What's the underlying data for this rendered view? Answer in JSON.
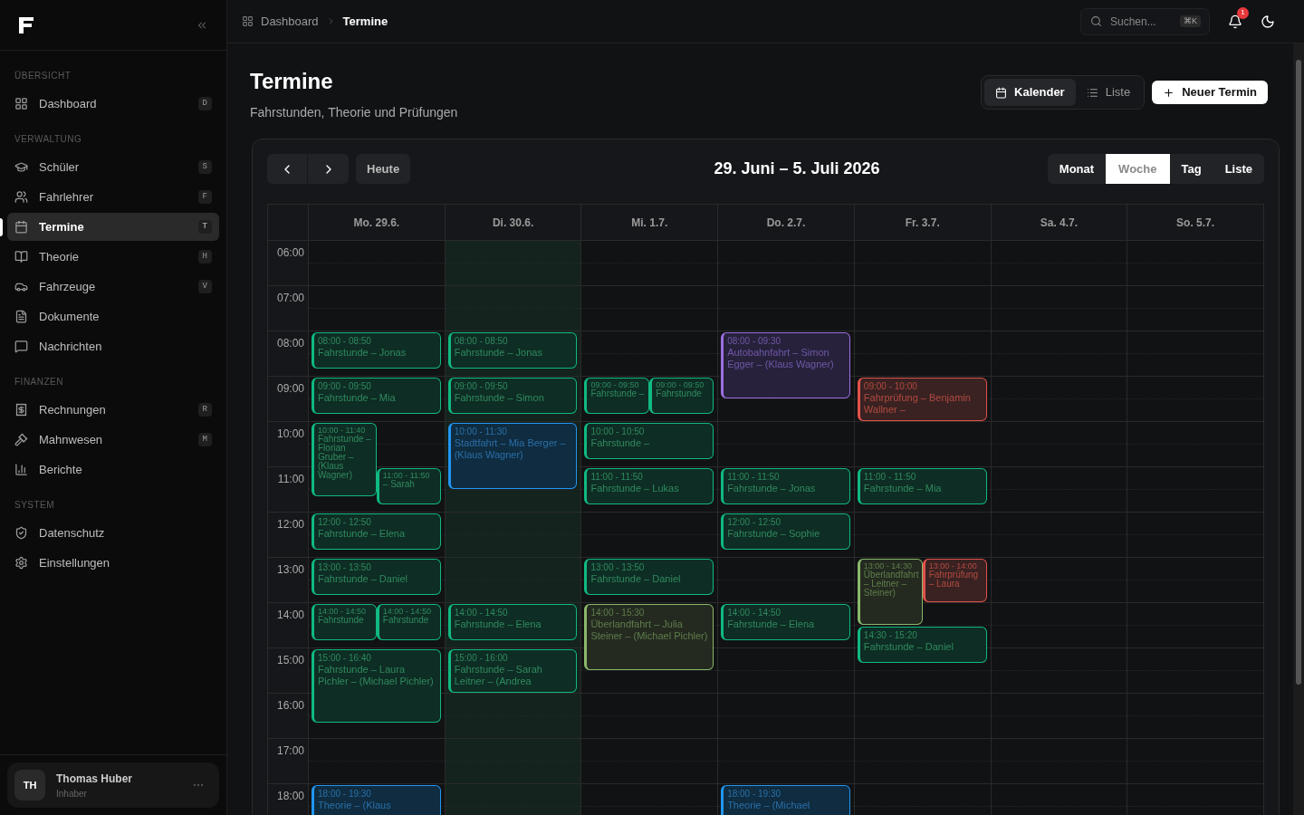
{
  "sidebar": {
    "sections": [
      {
        "title": "ÜBERSICHT",
        "items": [
          {
            "label": "Dashboard",
            "shortcut": "D",
            "selected": false
          }
        ]
      },
      {
        "title": "VERWALTUNG",
        "items": [
          {
            "label": "Schüler",
            "shortcut": "S",
            "selected": false
          },
          {
            "label": "Fahrlehrer",
            "shortcut": "F",
            "selected": false
          },
          {
            "label": "Termine",
            "shortcut": "T",
            "selected": true
          },
          {
            "label": "Theorie",
            "shortcut": "H",
            "selected": false
          },
          {
            "label": "Fahrzeuge",
            "shortcut": "V",
            "selected": false
          },
          {
            "label": "Dokumente",
            "selected": false
          },
          {
            "label": "Nachrichten",
            "selected": false
          }
        ]
      },
      {
        "title": "FINANZEN",
        "items": [
          {
            "label": "Rechnungen",
            "shortcut": "R",
            "selected": false
          },
          {
            "label": "Mahnwesen",
            "shortcut": "M",
            "selected": false
          },
          {
            "label": "Berichte",
            "selected": false
          }
        ]
      },
      {
        "title": "SYSTEM",
        "items": [
          {
            "label": "Datenschutz",
            "selected": false
          },
          {
            "label": "Einstellungen",
            "selected": false
          }
        ]
      }
    ],
    "user": {
      "initials": "TH",
      "name": "Thomas Huber",
      "role": "Inhaber"
    }
  },
  "topbar": {
    "breadcrumb": [
      "Dashboard",
      "Termine"
    ],
    "search": {
      "placeholder": "Suchen...",
      "shortcut": "⌘K"
    },
    "notifications": "1"
  },
  "header": {
    "title": "Termine",
    "subtitle": "Fahrstunden, Theorie und Prüfungen",
    "views": [
      {
        "label": "Kalender",
        "selected": true
      },
      {
        "label": "Liste",
        "selected": false
      }
    ],
    "new_button": "Neuer Termin"
  },
  "calendar": {
    "today_button": "Heute",
    "range": "29. Juni – 5. Juli 2026",
    "view_tabs": [
      {
        "label": "Monat",
        "selected": false
      },
      {
        "label": "Woche",
        "selected": true
      },
      {
        "label": "Tag",
        "selected": false
      },
      {
        "label": "Liste",
        "selected": false
      }
    ],
    "hours": [
      "06:00",
      "07:00",
      "08:00",
      "09:00",
      "10:00",
      "11:00",
      "12:00",
      "13:00",
      "14:00",
      "15:00",
      "16:00",
      "17:00",
      "18:00"
    ],
    "days": [
      {
        "label": "Mo. 29.6.",
        "today": false,
        "events": [
          {
            "kind": "lesson",
            "left_half": false,
            "right_half": false,
            "time": "08:00 - 08:50",
            "title": "Fahrstunde – Jonas"
          },
          {
            "kind": "lesson",
            "left_half": false,
            "right_half": false,
            "time": "09:00 - 09:50",
            "title": "Fahrstunde – Mia"
          },
          {
            "kind": "lesson",
            "left_half": true,
            "right_half": false,
            "time": "10:00 - 11:40",
            "title": "Fahrstunde – Florian Gruber – (Klaus Wagner)"
          },
          {
            "kind": "lesson",
            "left_half": false,
            "right_half": true,
            "time": "11:00 - 11:50",
            "title": "– Sarah"
          },
          {
            "kind": "lesson",
            "left_half": false,
            "right_half": false,
            "time": "12:00 - 12:50",
            "title": "Fahrstunde – Elena"
          },
          {
            "kind": "lesson",
            "left_half": false,
            "right_half": false,
            "time": "13:00 - 13:50",
            "title": "Fahrstunde – Daniel"
          },
          {
            "kind": "lesson",
            "left_half": true,
            "right_half": false,
            "time": "14:00 - 14:50",
            "title": "Fahrstunde"
          },
          {
            "kind": "lesson",
            "left_half": false,
            "right_half": true,
            "time": "14:00 - 14:50",
            "title": "Fahrstunde"
          },
          {
            "kind": "lesson",
            "left_half": false,
            "right_half": false,
            "time": "15:00 - 16:40",
            "title": "Fahrstunde – Laura Pichler – (Michael Pichler)"
          },
          {
            "kind": "theory",
            "left_half": false,
            "right_half": false,
            "time": "18:00 - 19:30",
            "title": "Theorie – (Klaus"
          }
        ]
      },
      {
        "label": "Di. 30.6.",
        "today": true,
        "events": [
          {
            "kind": "lesson",
            "left_half": false,
            "right_half": false,
            "time": "08:00 - 08:50",
            "title": "Fahrstunde – Jonas"
          },
          {
            "kind": "lesson",
            "left_half": false,
            "right_half": false,
            "time": "09:00 - 09:50",
            "title": "Fahrstunde – Simon"
          },
          {
            "kind": "theory",
            "left_half": false,
            "right_half": false,
            "time": "10:00 - 11:30",
            "title": "Stadtfahrt – Mia Berger – (Klaus Wagner)"
          },
          {
            "kind": "lesson",
            "left_half": false,
            "right_half": false,
            "time": "14:00 - 14:50",
            "title": "Fahrstunde – Elena"
          },
          {
            "kind": "lesson",
            "left_half": false,
            "right_half": false,
            "time": "15:00 - 16:00",
            "title": "Fahrstunde – Sarah Leitner – (Andrea"
          }
        ]
      },
      {
        "label": "Mi. 1.7.",
        "today": false,
        "events": [
          {
            "kind": "lesson",
            "left_half": true,
            "right_half": false,
            "time": "09:00 - 09:50",
            "title": "Fahrstunde –"
          },
          {
            "kind": "lesson",
            "left_half": false,
            "right_half": true,
            "time": "09:00 - 09:50",
            "title": "Fahrstunde"
          },
          {
            "kind": "lesson",
            "left_half": false,
            "right_half": false,
            "time": "10:00 - 10:50",
            "title": "Fahrstunde –"
          },
          {
            "kind": "lesson",
            "left_half": false,
            "right_half": false,
            "time": "11:00 - 11:50",
            "title": "Fahrstunde – Lukas"
          },
          {
            "kind": "lesson",
            "left_half": false,
            "right_half": false,
            "time": "13:00 - 13:50",
            "title": "Fahrstunde – Daniel"
          },
          {
            "kind": "overland",
            "left_half": false,
            "right_half": false,
            "time": "14:00 - 15:30",
            "title": "Überlandfahrt – Julia Steiner – (Michael Pichler)"
          }
        ]
      },
      {
        "label": "Do. 2.7.",
        "today": false,
        "events": [
          {
            "kind": "highway",
            "left_half": false,
            "right_half": false,
            "time": "08:00 - 09:30",
            "title": "Autobahnfahrt – Simon Egger – (Klaus Wagner)"
          },
          {
            "kind": "lesson",
            "left_half": false,
            "right_half": false,
            "time": "11:00 - 11:50",
            "title": "Fahrstunde – Jonas"
          },
          {
            "kind": "lesson",
            "left_half": false,
            "right_half": false,
            "time": "12:00 - 12:50",
            "title": "Fahrstunde – Sophie"
          },
          {
            "kind": "lesson",
            "left_half": false,
            "right_half": false,
            "time": "14:00 - 14:50",
            "title": "Fahrstunde – Elena"
          },
          {
            "kind": "theory",
            "left_half": false,
            "right_half": false,
            "time": "18:00 - 19:30",
            "title": "Theorie – (Michael"
          }
        ]
      },
      {
        "label": "Fr. 3.7.",
        "today": false,
        "events": [
          {
            "kind": "exam",
            "left_half": false,
            "right_half": false,
            "time": "09:00 - 10:00",
            "title": "Fahrprüfung – Benjamin Wallner –"
          },
          {
            "kind": "lesson",
            "left_half": false,
            "right_half": false,
            "time": "11:00 - 11:50",
            "title": "Fahrstunde – Mia"
          },
          {
            "kind": "overland",
            "left_half": true,
            "right_half": false,
            "time": "13:00 - 14:30",
            "title": "Überlandfahrt – Leitner – Steiner)"
          },
          {
            "kind": "exam",
            "left_half": false,
            "right_half": true,
            "time": "13:00 - 14:00",
            "title": "Fahrprüfung – Laura"
          },
          {
            "kind": "lesson",
            "left_half": false,
            "right_half": false,
            "time": "14:30 - 15:20",
            "title": "Fahrstunde – Daniel"
          }
        ]
      },
      {
        "label": "Sa. 4.7.",
        "today": false
      },
      {
        "label": "So. 5.7.",
        "today": false
      }
    ]
  }
}
